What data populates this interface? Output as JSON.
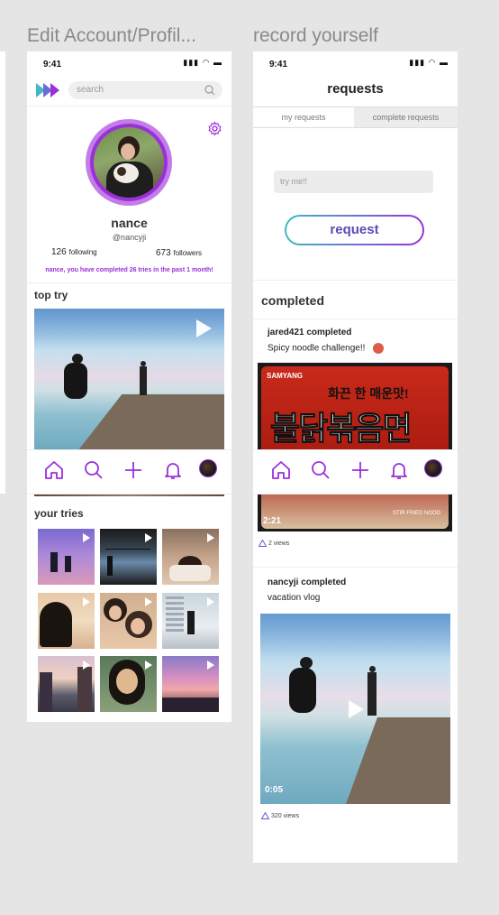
{
  "frames": {
    "left_title": "Edit Account/Profil...",
    "right_title": "record yourself"
  },
  "profile": {
    "status_time": "9:41",
    "status_icons": "▮▮▮ ◠ ▬",
    "search_placeholder": "search",
    "name": "nance",
    "handle": "@nancyji",
    "following_count": "126",
    "following_label": "following",
    "followers_count": "673",
    "followers_label": "followers",
    "completion_note": "nance, you have completed 26 tries in the past 1 month!",
    "top_try_heading": "top try",
    "your_tries_heading": "your tries"
  },
  "requests": {
    "status_time": "9:41",
    "status_icons": "▮▮▮ ◠ ▬",
    "title": "requests",
    "tab_my": "my requests",
    "tab_complete": "complete requests",
    "input_placeholder": "try me!!",
    "request_button": "request",
    "completed_heading": "completed",
    "items": [
      {
        "user_line": "jared421 completed",
        "caption": "Spicy noodle challenge!!",
        "duration": "2:21",
        "views": "2 views"
      },
      {
        "user_line": "nancyji completed",
        "caption": "vacation vlog",
        "duration": "0:05",
        "views": "320 views"
      }
    ]
  },
  "package": {
    "brand": "SAMYANG",
    "korean_top": "화끈 한 매운맛!",
    "korean_main": "불닭볶음면",
    "side_text": "STIR FRIED NOOD"
  },
  "nav_icons": [
    "home-icon",
    "search-icon",
    "plus-icon",
    "bell-icon",
    "avatar"
  ],
  "colors": {
    "accent": "#9b30d9",
    "teal": "#3fb8c8"
  }
}
